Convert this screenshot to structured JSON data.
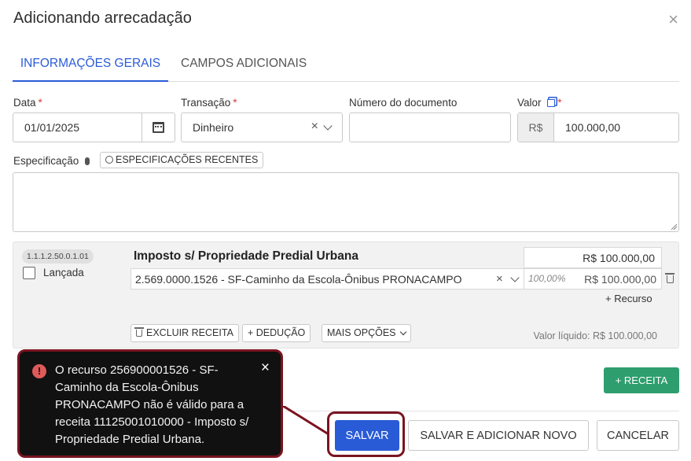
{
  "modal": {
    "title": "Adicionando arrecadação",
    "close": "×"
  },
  "tabs": [
    {
      "label": "INFORMAÇÕES GERAIS",
      "active": true
    },
    {
      "label": "CAMPOS ADICIONAIS",
      "active": false
    }
  ],
  "form": {
    "data": {
      "label": "Data",
      "required": "*",
      "value": "01/01/2025"
    },
    "transacao": {
      "label": "Transação",
      "required": "*",
      "value": "Dinheiro"
    },
    "numero_documento": {
      "label": "Número do documento",
      "value": ""
    },
    "valor": {
      "label": "Valor",
      "required": "*",
      "prefix": "R$",
      "value": "100.000,00"
    },
    "especificacao": {
      "label": "Especificação",
      "recentes_button": "ESPECIFICAÇÕES RECENTES",
      "value": ""
    }
  },
  "receita": {
    "code": "1.1.1.2.50.0.1.01",
    "lancada_label": "Lançada",
    "title": "Imposto s/ Propriedade Predial Urbana",
    "total": "R$ 100.000,00",
    "recurso": {
      "name": "2.569.0000.1526 - SF-Caminho da Escola-Ônibus PRONACAMPO",
      "percent": "100,00%",
      "value": "R$ 100.000,00"
    },
    "add_recurso": "+ Recurso",
    "buttons": {
      "excluir": "EXCLUIR RECEITA",
      "deducao": "+ DEDUÇÃO",
      "mais_opcoes": "MAIS OPÇÕES"
    },
    "valor_liquido": "Valor líquido: R$ 100.000,00"
  },
  "add_receita_button": "+ RECEITA",
  "footer": {
    "salvar": "SALVAR",
    "salvar_novo": "SALVAR E ADICIONAR NOVO",
    "cancelar": "CANCELAR"
  },
  "toast": {
    "message": "O recurso 256900001526 - SF-Caminho da Escola-Ônibus PRONACAMPO não é válido para a receita 11125001010000 - Imposto s/ Propriedade Predial Urbana.",
    "icon": "!",
    "close": "×"
  },
  "colors": {
    "primary": "#2a5bd7",
    "success": "#2e9e6e",
    "highlight": "#7a1420",
    "error_icon": "#e05a5a"
  }
}
